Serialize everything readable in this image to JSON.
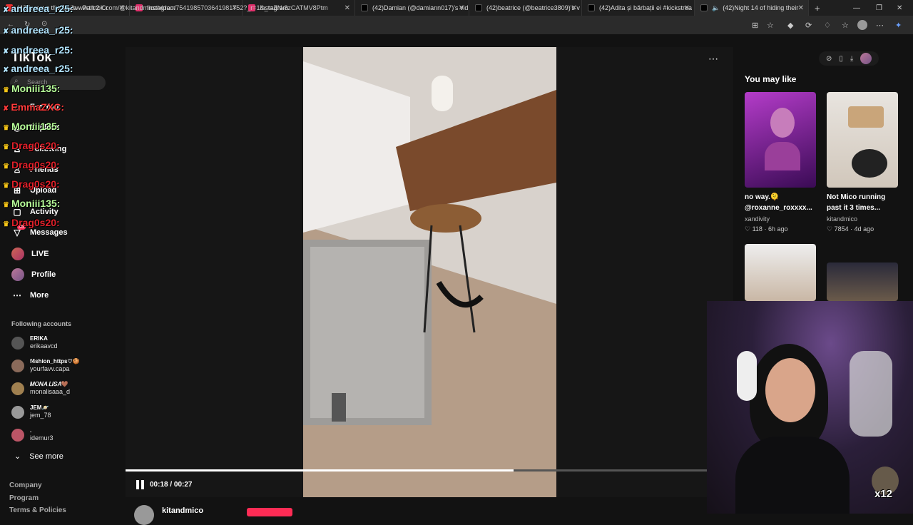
{
  "browser": {
    "tabs": [
      {
        "label": "(42)Low on the Brain - Part 2 Cr",
        "icon_color": "#e33"
      },
      {
        "label": "Instagram",
        "icon_color": "#e1306c"
      },
      {
        "label": "Instagram",
        "icon_color": "#e1306c"
      },
      {
        "label": "(42)Damian (@damiann017)'s vid",
        "icon_color": "#111"
      },
      {
        "label": "(42)beatrice (@beatrice3809)'s v",
        "icon_color": "#111"
      },
      {
        "label": "(42)Adita și bărbații ei #kickstrea",
        "icon_color": "#111"
      },
      {
        "label": "(42)Night 14 of hiding their",
        "icon_color": "#111"
      }
    ],
    "url": "https://www.tiktok.com/@kitandmico/video/7541985703641981752?_r=1&_t=ZN-8zCATMV8Ptm"
  },
  "sidebar": {
    "logo": "TikTok",
    "search_placeholder": "Search",
    "nav": [
      {
        "label": "For You",
        "icon": "home-icon"
      },
      {
        "label": "Explore",
        "icon": "compass-icon"
      },
      {
        "label": "Following",
        "icon": "following-icon"
      },
      {
        "label": "Friends",
        "icon": "friends-icon"
      },
      {
        "label": "Upload",
        "icon": "plus-icon"
      },
      {
        "label": "Activity",
        "icon": "activity-icon"
      },
      {
        "label": "Messages",
        "icon": "messages-icon",
        "badge": "35"
      },
      {
        "label": "LIVE",
        "icon": "live-icon"
      },
      {
        "label": "Profile",
        "icon": "avatar"
      },
      {
        "label": "More",
        "icon": "more-icon"
      }
    ],
    "following_title": "Following accounts",
    "accounts": [
      {
        "name": "ERIKA",
        "handle": "erikaavcd"
      },
      {
        "name": "f4shion_https♡🍪",
        "handle": "yourfavv.capa"
      },
      {
        "name": "𝑀𝑂𝑁𝐴 𝐿𝐼𝑆𝐴🤎",
        "handle": "monalisaaa_d"
      },
      {
        "name": "JEM🪐",
        "handle": "jem_78"
      },
      {
        "name": ".",
        "handle": "idemur3"
      }
    ],
    "see_more": "See more",
    "footer": [
      "Company",
      "Program",
      "Terms & Policies"
    ]
  },
  "chat_overlay": [
    {
      "user": "andreea_r25:",
      "color": "#b3e5ff"
    },
    {
      "user": "andreea_r25:",
      "color": "#b3e5ff"
    },
    {
      "user": "andreea_r25:",
      "color": "#b3e5ff"
    },
    {
      "user": "andreea_r25:",
      "color": "#b3e5ff"
    },
    {
      "user": "Moniii135:",
      "color": "#b8ff9a"
    },
    {
      "user": "EmmaZXC:",
      "color": "#ff3b3b"
    },
    {
      "user": "Moniii135:",
      "color": "#b8ff9a"
    },
    {
      "user": "Drag0s20:",
      "color": "#e0202a"
    },
    {
      "user": "Drag0s20:",
      "color": "#e0202a"
    },
    {
      "user": "Drag0s20:",
      "color": "#e0202a"
    },
    {
      "user": "Moniii135:",
      "color": "#b8ff9a"
    },
    {
      "user": "Drag0s20:",
      "color": "#e0202a"
    }
  ],
  "player": {
    "current_time": "00:18",
    "duration": "00:27",
    "time_display": "00:18 / 00:27",
    "progress_fraction": 0.667
  },
  "rail": {
    "title": "You may like",
    "items": [
      {
        "caption": "no way.🫠 @roxanne_roxxxx...",
        "author": "xandivity",
        "likes": "118",
        "age": "6h ago"
      },
      {
        "caption": "Not Mico running past it 3 times...",
        "author": "kitandmico",
        "likes": "7854",
        "age": "4d ago"
      }
    ]
  },
  "stream": {
    "multiplier": "x12"
  },
  "bottom": {
    "username": "kitandmico"
  }
}
